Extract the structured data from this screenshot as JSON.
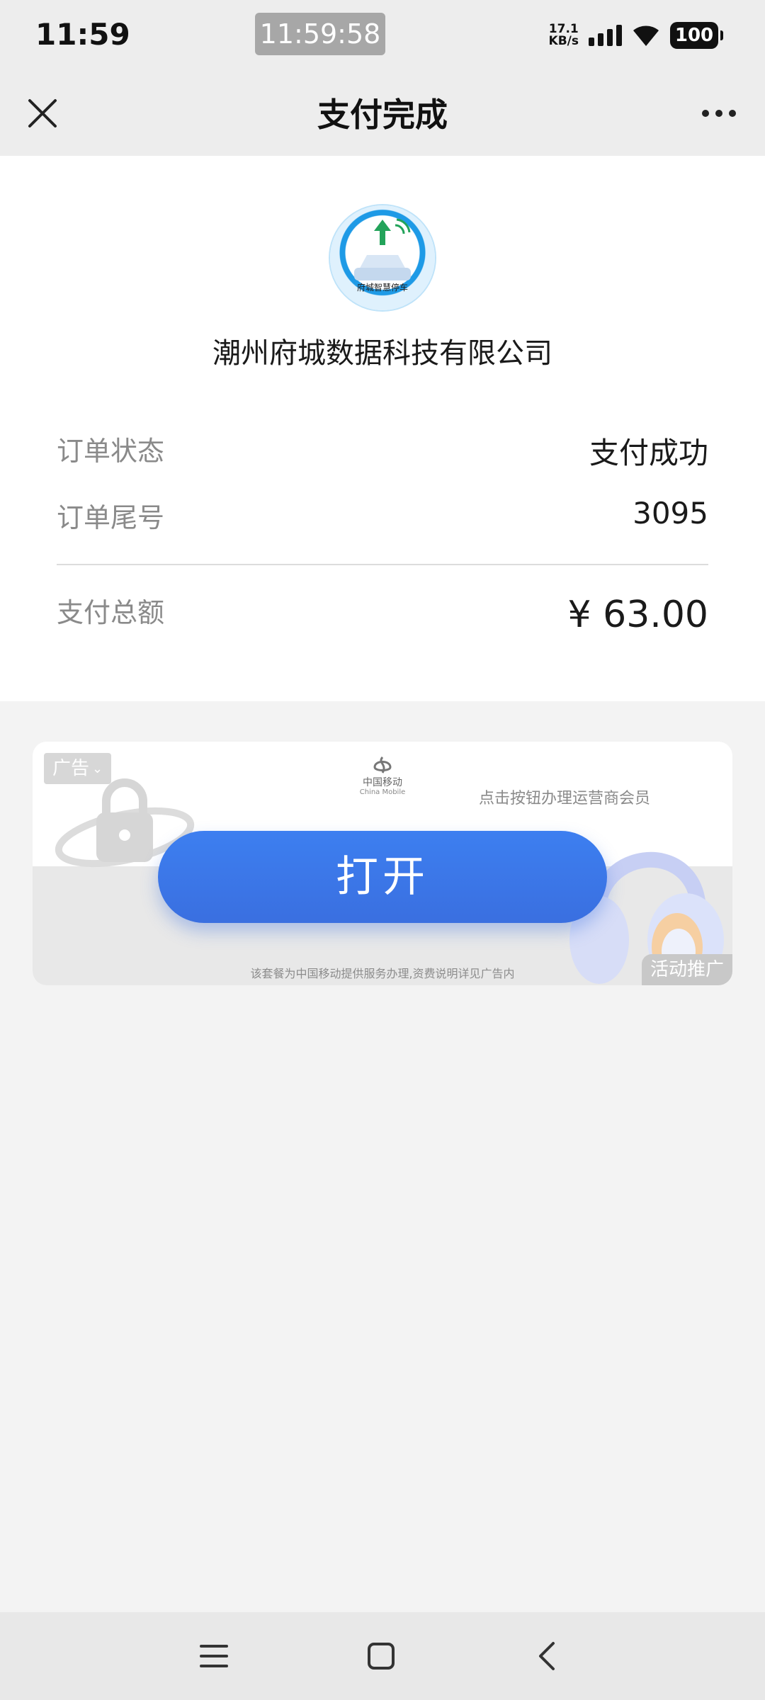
{
  "status_bar": {
    "time": "11:59",
    "center_time": "11:59:58",
    "net_speed_value": "17.1",
    "net_speed_unit": "KB/s",
    "battery": "100"
  },
  "nav": {
    "title": "支付完成",
    "close_icon": "close-icon",
    "more_icon": "more-icon"
  },
  "merchant": {
    "logo_text": "府城智慧停车",
    "name": "潮州府城数据科技有限公司"
  },
  "order": {
    "status_label": "订单状态",
    "status_value": "支付成功",
    "tail_label": "订单尾号",
    "tail_value": "3095",
    "total_label": "支付总额",
    "total_value": "¥ 63.00"
  },
  "ad": {
    "tag": "广告",
    "brand_zh": "中国移动",
    "brand_en": "China Mobile",
    "promo_text": "点击按钮办理运营商会员",
    "button_label": "打开",
    "disclaimer": "该套餐为中国移动提供服务办理,资费说明详见广告内",
    "activity_label": "活动推广"
  },
  "colors": {
    "accent_button": "#3a73e6",
    "page_bg": "#f3f3f3",
    "nav_bg": "#ededed"
  }
}
